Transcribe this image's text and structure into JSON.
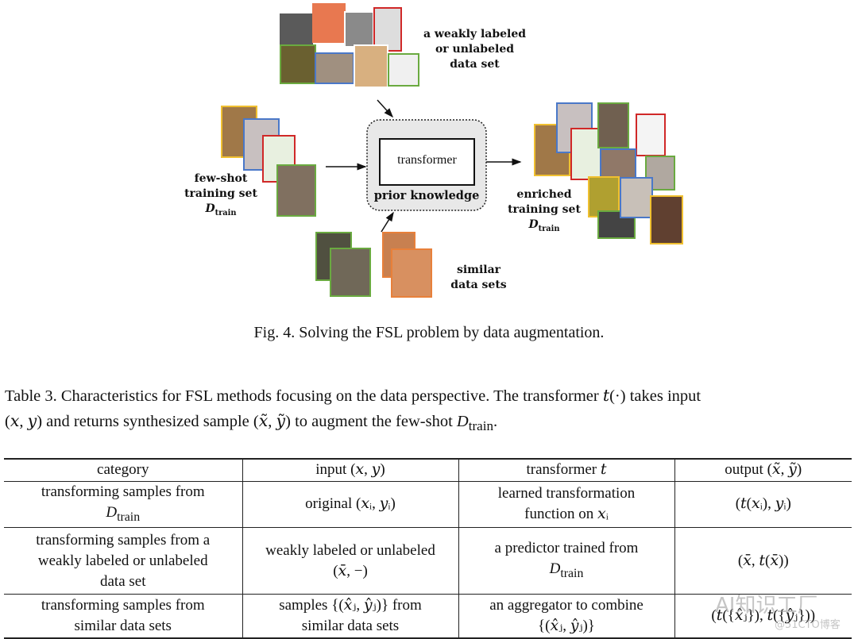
{
  "figure": {
    "labels": {
      "weak": [
        "a weakly labeled",
        "or unlabeled",
        "data set"
      ],
      "fewshot": [
        "few-shot",
        "training set"
      ],
      "enriched": [
        "enriched",
        "training set"
      ],
      "similar": [
        "similar",
        "data sets"
      ],
      "d": "D",
      "train": "train",
      "transformer": "transformer",
      "prior": "prior knowledge"
    },
    "colors": {
      "yellow": "#f0c030",
      "blue": "#4a78c8",
      "red": "#d02828",
      "green": "#6aaa40",
      "orange": "#e8803a",
      "box": "#e8e8e8"
    },
    "caption": "Fig. 4.  Solving the FSL problem by data augmentation."
  },
  "table_caption": {
    "line1": "Table 3.  Characteristics for FSL methods focusing on the data perspective. The transformer 𝑡(·) takes input",
    "line2a": "(𝑥, 𝑦) and returns synthesized sample (𝑥̃, 𝑦̃) to augment the few-shot ",
    "d": "D",
    "train": "train",
    "end": "."
  },
  "table": {
    "headers": [
      "category",
      "input (𝑥, 𝑦)",
      "transformer 𝑡",
      "output (𝑥̃, 𝑦̃)"
    ],
    "rows": [
      {
        "c1a": "transforming samples from",
        "c1d": "D",
        "c1sub": "train",
        "c2": "original (𝑥ᵢ, 𝑦ᵢ)",
        "c3a": "learned transformation",
        "c3b": "function on 𝑥ᵢ",
        "c4": "(𝑡(𝑥ᵢ), 𝑦ᵢ)"
      },
      {
        "c1a": "transforming samples from a",
        "c1b": "weakly labeled or unlabeled",
        "c1c": "data set",
        "c2a": "weakly labeled or unlabeled",
        "c2b": "(𝑥̄, −)",
        "c3a": "a predictor trained from",
        "c3d": "D",
        "c3sub": "train",
        "c4": "(𝑥̄, 𝑡(𝑥̄))"
      },
      {
        "c1a": "transforming samples from",
        "c1b": "similar data sets",
        "c2a": "samples {(𝑥̂ⱼ, 𝑦̂ⱼ)} from",
        "c2b": "similar data sets",
        "c3a": "an aggregator to combine",
        "c3b": "{(𝑥̂ⱼ, 𝑦̂ⱼ)}",
        "c4": "(𝑡({𝑥̂ⱼ}), 𝑡({𝑦̂ⱼ}))"
      }
    ]
  },
  "watermark": {
    "main": "AI知识工厂",
    "sub": "@51CTO博客"
  }
}
